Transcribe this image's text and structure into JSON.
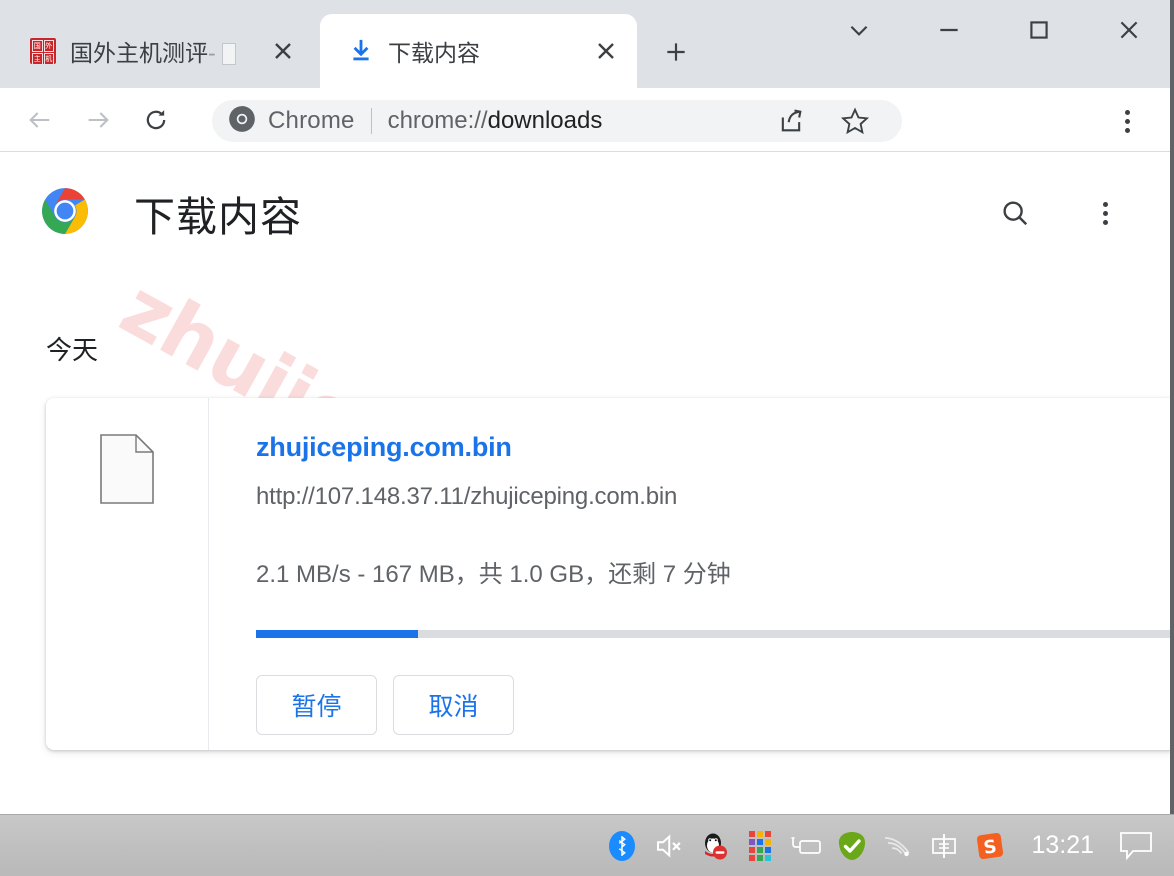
{
  "window": {
    "controls": [
      {
        "name": "tab-search",
        "glyph": "chevron-down"
      },
      {
        "name": "minimize",
        "glyph": "minimize"
      },
      {
        "name": "maximize",
        "glyph": "maximize"
      },
      {
        "name": "close",
        "glyph": "close"
      }
    ]
  },
  "tabs": [
    {
      "title": "国外主机测评",
      "separator": "-",
      "favicon": "red-site-favicon",
      "active": false,
      "close_label": "✕"
    },
    {
      "title": "下载内容",
      "favicon": "download-icon",
      "active": true,
      "close_label": "✕"
    }
  ],
  "new_tab_label": "+",
  "toolbar": {
    "back_label": "←",
    "forward_label": "→",
    "reload_label": "⟳",
    "omnibox": {
      "brand": "Chrome",
      "url_prefix": "chrome://",
      "url_bold": "downloads",
      "full_url": "chrome://downloads"
    },
    "share_label": "share-icon",
    "bookmark_label": "star-icon",
    "menu_label": "three-dot-menu"
  },
  "page": {
    "title": "下载内容",
    "search_label": "搜索",
    "menu_label": "更多操作",
    "watermark": "zhujiceping.com",
    "section_label": "今天",
    "download": {
      "filename": "zhujiceping.com.bin",
      "url": "http://107.148.37.11/zhujiceping.com.bin",
      "status": "2.1 MB/s - 167 MB，共 1.0 GB，还剩 7 分钟",
      "speed": "2.1 MB/s",
      "downloaded": "167 MB",
      "total_size": "1.0 GB",
      "time_remaining": "7 分钟",
      "progress_percent": 14.7,
      "progress_color": "#1a73e8",
      "buttons": [
        {
          "label": "暂停",
          "name": "pause-button"
        },
        {
          "label": "取消",
          "name": "cancel-button"
        }
      ]
    }
  },
  "taskbar": {
    "clock": "13:21",
    "tray": [
      {
        "name": "bluetooth-icon",
        "title": "Bluetooth"
      },
      {
        "name": "volume-muted-icon",
        "title": "音量已静音"
      },
      {
        "name": "qq-icon",
        "title": "QQ"
      },
      {
        "name": "color-squares-icon",
        "title": "应用"
      },
      {
        "name": "battery-charging-icon",
        "title": "电池"
      },
      {
        "name": "security-check-icon",
        "title": "安全"
      },
      {
        "name": "wifi-icon",
        "title": "网络"
      },
      {
        "name": "ime-chinese-icon",
        "title": "中"
      },
      {
        "name": "sogou-icon",
        "title": "搜狗输入法"
      }
    ],
    "notification_label": "通知"
  },
  "colors": {
    "accent": "#1a73e8",
    "tabstrip_bg": "#dee1e6",
    "taskbar_bg": "#c0c0c0",
    "watermark": "#fbdcdc"
  }
}
